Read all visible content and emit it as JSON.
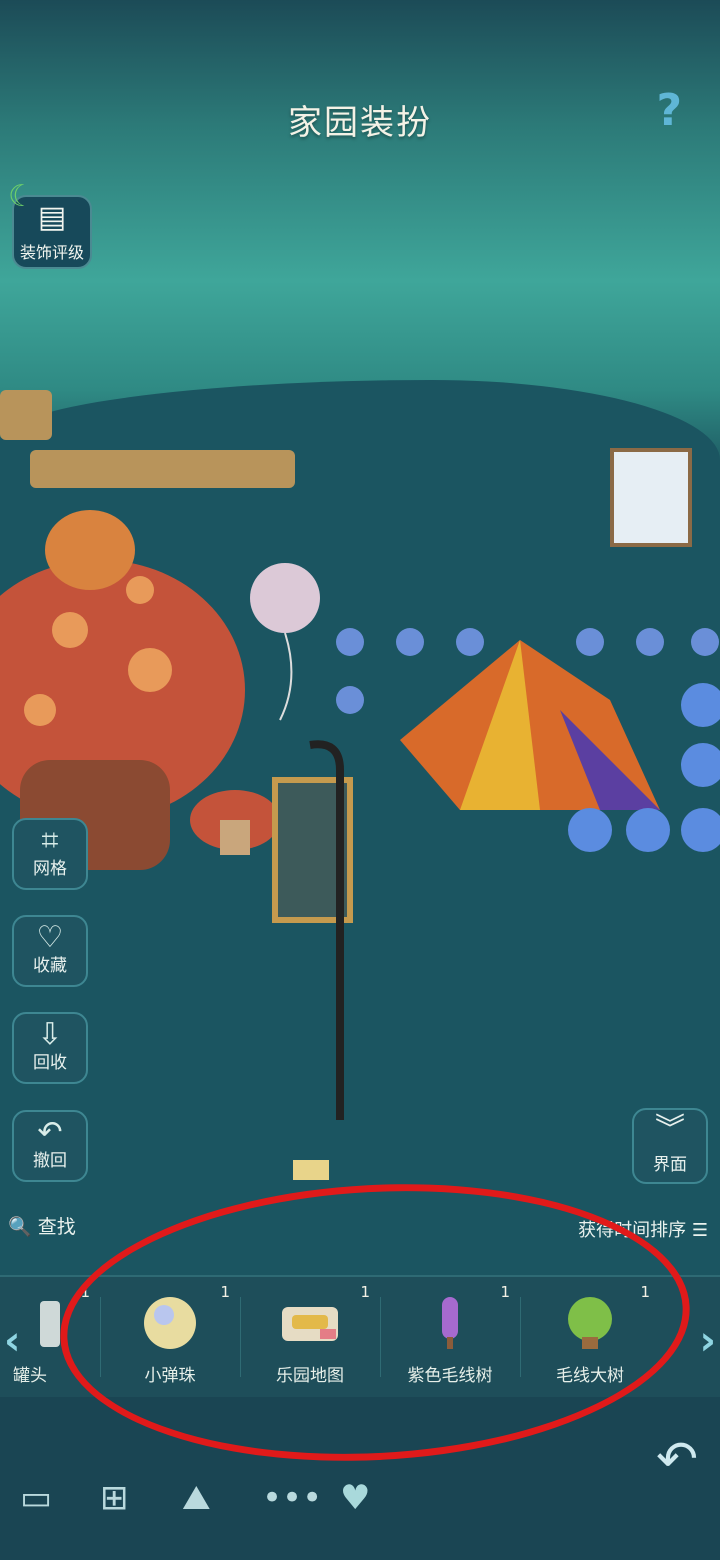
{
  "header": {
    "title": "家园装扮",
    "help_icon": "question-icon"
  },
  "rating_button": {
    "label": "装饰评级",
    "icon": "rating-book-icon"
  },
  "side_buttons": [
    {
      "label": "网格",
      "icon": "grid-icon"
    },
    {
      "label": "收藏",
      "icon": "heart-outline-icon"
    },
    {
      "label": "回收",
      "icon": "recycle-icon"
    },
    {
      "label": "撤回",
      "icon": "undo-arrow-icon"
    }
  ],
  "ui_toggle": {
    "label": "界面",
    "icon": "double-chevron-down-icon"
  },
  "search": {
    "label": "查找"
  },
  "sort": {
    "label": "获得时间排序"
  },
  "items": [
    {
      "label": "罐头",
      "count": "1"
    },
    {
      "label": "小弹珠",
      "count": "1"
    },
    {
      "label": "乐园地图",
      "count": "1"
    },
    {
      "label": "紫色毛线树",
      "count": "1"
    },
    {
      "label": "毛线大树",
      "count": "1"
    }
  ],
  "bottom_nav": [
    {
      "icon": "sofa-icon"
    },
    {
      "icon": "fence-icon"
    },
    {
      "icon": "landscape-icon"
    },
    {
      "icon": "more-dots-icon"
    },
    {
      "icon": "heart-icon"
    }
  ],
  "colors": {
    "annotation_circle": "#e01a1a",
    "accent": "#8fd5e2"
  }
}
